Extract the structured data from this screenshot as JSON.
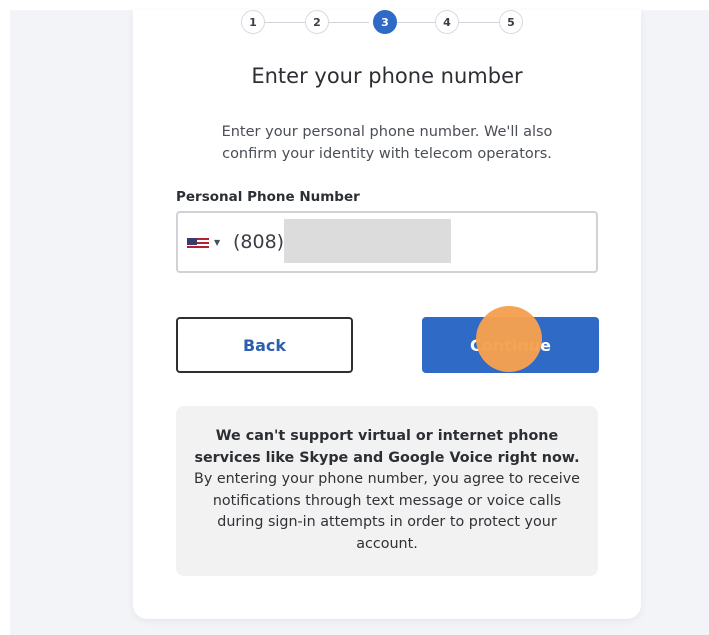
{
  "stepper": {
    "steps": [
      "1",
      "2",
      "3",
      "4",
      "5"
    ],
    "active_step": "3"
  },
  "page": {
    "title": "Enter your phone number",
    "subtitle": "Enter your personal phone number. We'll also confirm your identity with telecom operators."
  },
  "phone": {
    "label": "Personal Phone Number",
    "country": "US",
    "flag_icon": "us-flag-icon",
    "value_prefix": "(808)"
  },
  "buttons": {
    "back_label": "Back",
    "continue_label": "Continue"
  },
  "notice": {
    "bold_text": "We can't support virtual or internet phone services like Skype and Google Voice right now.",
    "body_text": "By entering your phone number, you agree to receive notifications through text message or voice calls during sign-in attempts in order to protect your account."
  },
  "colors": {
    "accent": "#2f6bc6",
    "cursor_highlight": "#f5a14f",
    "notice_bg": "#f2f2f2"
  }
}
